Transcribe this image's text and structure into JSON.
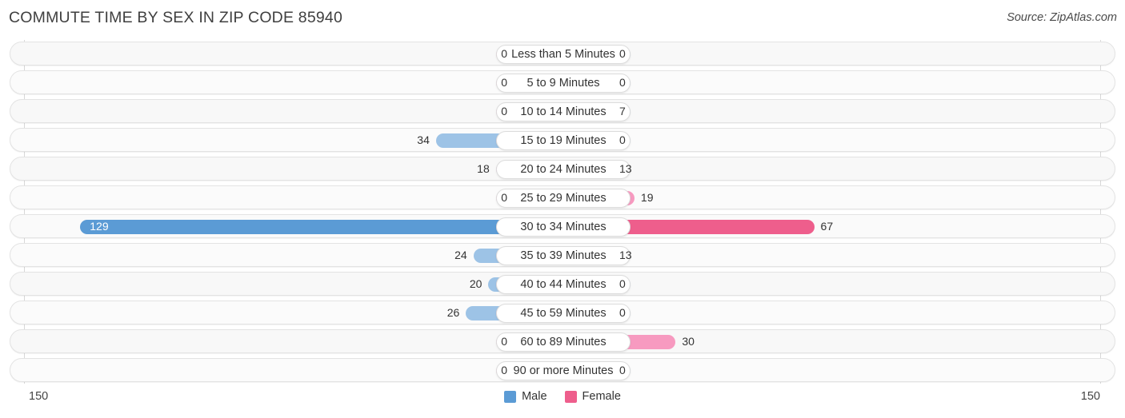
{
  "header": {
    "title": "COMMUTE TIME BY SEX IN ZIP CODE 85940",
    "source": "Source: ZipAtlas.com"
  },
  "legend": {
    "male": {
      "label": "Male",
      "color": "#5b9bd5"
    },
    "female": {
      "label": "Female",
      "color": "#ee5e8c"
    }
  },
  "axis": {
    "left_max": "150",
    "right_max": "150"
  },
  "chart_data": {
    "type": "bar",
    "title": "COMMUTE TIME BY SEX IN ZIP CODE 85940",
    "orientation": "horizontal-diverging",
    "xlabel": "",
    "ylabel": "",
    "xlim": [
      150,
      150
    ],
    "grid": false,
    "legend_position": "bottom-center",
    "categories": [
      "Less than 5 Minutes",
      "5 to 9 Minutes",
      "10 to 14 Minutes",
      "15 to 19 Minutes",
      "20 to 24 Minutes",
      "25 to 29 Minutes",
      "30 to 34 Minutes",
      "35 to 39 Minutes",
      "40 to 44 Minutes",
      "45 to 59 Minutes",
      "60 to 89 Minutes",
      "90 or more Minutes"
    ],
    "series": [
      {
        "name": "Male",
        "color": "#9dc3e6",
        "values": [
          0,
          0,
          0,
          34,
          18,
          0,
          129,
          24,
          20,
          26,
          0,
          0
        ]
      },
      {
        "name": "Female",
        "color": "#f79ac0",
        "values": [
          0,
          0,
          7,
          0,
          13,
          19,
          67,
          13,
          0,
          0,
          30,
          0
        ]
      }
    ],
    "highlight_row_index": 6,
    "highlight_colors": {
      "male": "#5b9bd5",
      "female": "#ee5e8c"
    }
  }
}
